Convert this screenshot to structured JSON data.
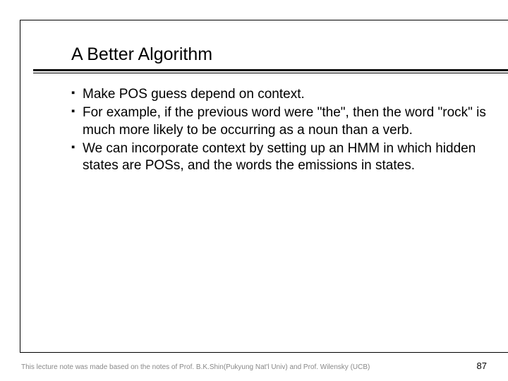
{
  "title": "A Better Algorithm",
  "bullets": [
    "Make POS guess depend on context.",
    "For example, if the previous word were \"the\", then the word \"rock\" is much more likely to be occurring as a noun than a verb.",
    "We can incorporate context by setting up an HMM in which hidden states are POSs, and the words the emissions in states."
  ],
  "footer_note": "This lecture note was made based on the notes of Prof. B.K.Shin(Pukyung Nat'l Univ) and Prof. Wilensky (UCB)",
  "page_number": "87"
}
